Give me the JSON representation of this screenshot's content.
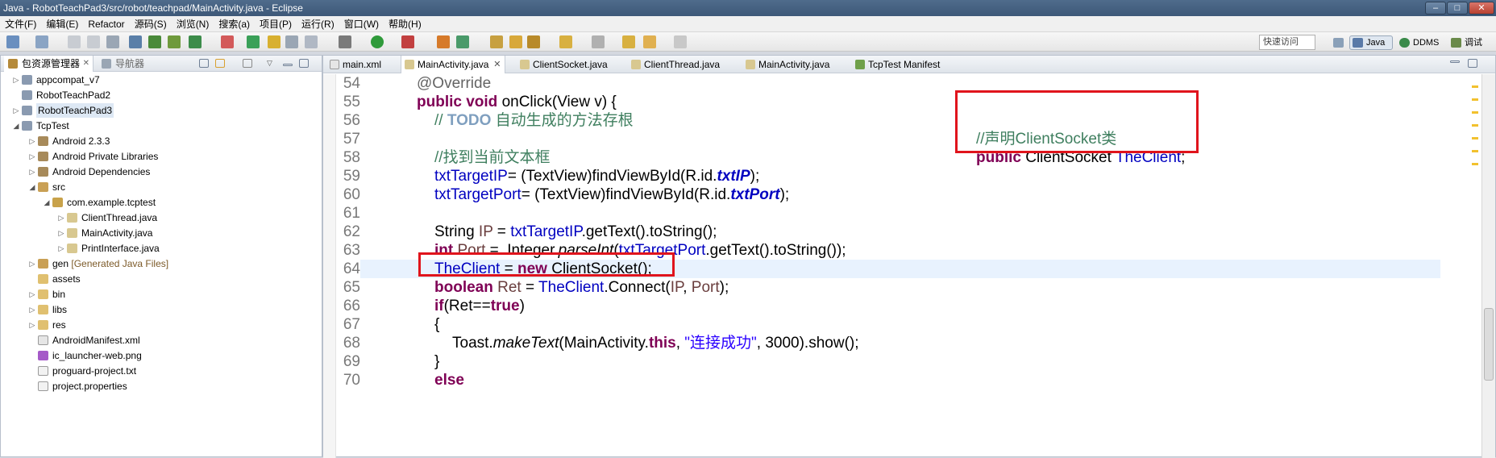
{
  "window": {
    "title": "Java  -  RobotTeachPad3/src/robot/teachpad/MainActivity.java  -  Eclipse",
    "min": "–",
    "max": "□",
    "close": "✕"
  },
  "menu": [
    "文件(F)",
    "编辑(E)",
    "Refactor",
    "源码(S)",
    "浏览(N)",
    "搜索(a)",
    "项目(P)",
    "运行(R)",
    "窗口(W)",
    "帮助(H)"
  ],
  "toolbar": {
    "quick_access": "快速访问",
    "perspectives": [
      "Java",
      "DDMS",
      "调试"
    ]
  },
  "package_explorer": {
    "tabs": [
      "包资源管理器",
      "导航器"
    ],
    "tree": [
      {
        "label": "appcompat_v7",
        "twist": "▷"
      },
      {
        "label": "RobotTeachPad2",
        "twist": ""
      },
      {
        "label": "RobotTeachPad3",
        "twist": "▷"
      },
      {
        "label": "TcpTest",
        "twist": "◢"
      },
      {
        "label": "Android 2.3.3",
        "twist": "▷"
      },
      {
        "label": "Android Private Libraries",
        "twist": "▷"
      },
      {
        "label": "Android Dependencies",
        "twist": "▷"
      },
      {
        "label": "src",
        "twist": "◢"
      },
      {
        "label": "com.example.tcptest",
        "twist": "◢"
      },
      {
        "label": "ClientThread.java",
        "twist": "▷"
      },
      {
        "label": "MainActivity.java",
        "twist": "▷"
      },
      {
        "label": "PrintInterface.java",
        "twist": "▷"
      },
      {
        "label": "gen",
        "decoration": "[Generated Java Files]",
        "twist": "▷"
      },
      {
        "label": "assets",
        "twist": ""
      },
      {
        "label": "bin",
        "twist": "▷"
      },
      {
        "label": "libs",
        "twist": "▷"
      },
      {
        "label": "res",
        "twist": "▷"
      },
      {
        "label": "AndroidManifest.xml",
        "twist": ""
      },
      {
        "label": "ic_launcher-web.png",
        "twist": ""
      },
      {
        "label": "proguard-project.txt",
        "twist": ""
      },
      {
        "label": "project.properties",
        "twist": ""
      }
    ]
  },
  "editor": {
    "tabs": [
      "main.xml",
      "MainActivity.java",
      "ClientSocket.java",
      "ClientThread.java",
      "MainActivity.java",
      "TcpTest Manifest"
    ],
    "active_tab": 1,
    "line_numbers": [
      "54",
      "55",
      "56",
      "57",
      "58",
      "59",
      "60",
      "61",
      "62",
      "63",
      "64",
      "65",
      "66",
      "67",
      "68",
      "69",
      "70"
    ],
    "current_line": "64",
    "code": {
      "override": "@Override",
      "public": "public",
      "void": "void",
      "onclick_sig": " onClick(View v) {",
      "todo_prefix": "// ",
      "todo": "TODO",
      "todo_text": " 自动生成的方法存根",
      "find_comment": "//找到当前文本框",
      "txtTargetIP": "txtTargetIP",
      "txtTargetPort": "txtTargetPort",
      "cast_find": "= (TextView)findViewById(R.id.",
      "txtIP": "txtIP",
      "txtPort": "txtPort",
      "close_paren_semi": ");",
      "string_kw": "String ",
      "ip_var": "IP",
      "assign": " = ",
      "gettext": ".getText().toString();",
      "int_kw": "int",
      "port_var": " Port",
      "assign2": " =  Integer.",
      "parseInt": "parseInt",
      "open_paren": "(",
      "gettext2": ".getText().toString());",
      "theclient": "TheClient",
      "new_kw": "new",
      "new_rest": " ClientSocket();",
      "boolean_kw": "boolean",
      "ret_var": " Ret",
      "connect": ".Connect(",
      "comma": ", ",
      "port_var2": "Port",
      "connect_end": ");",
      "if_kw": "if",
      "ret_cond": "(Ret==",
      "true_kw": "true",
      "close_paren": ")",
      "lbrace": "{",
      "toast": "Toast.",
      "makeText": "makeText",
      "toast_mid": "(MainActivity.",
      "this_kw": "this",
      "toast_str": "\"连接成功\"",
      "toast_end": ", 3000).show();",
      "rbrace": "}",
      "else_kw": "else",
      "decl_comment": "//声明ClientSocket类",
      "decl_public": "public",
      "decl_type": " ClientSocket ",
      "decl_field": "TheClient",
      "decl_semi": ";"
    }
  },
  "colors": {
    "highlight_box": "#e0141c",
    "keyword": "#7f0055",
    "field": "#0000c0",
    "comment": "#3f7f5f",
    "string": "#2a00ff"
  }
}
